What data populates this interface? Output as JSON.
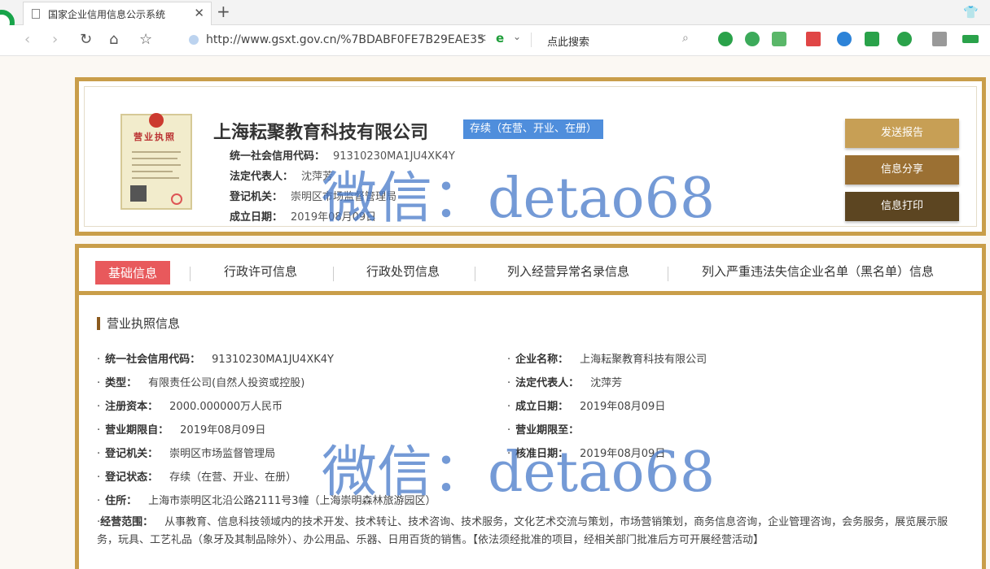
{
  "browser": {
    "tab_title": "国家企业信用信息公示系统",
    "tab_close": "✕",
    "new_tab": "+",
    "url": "http://www.gsxt.gov.cn/%7BDABF0FE7B29EAE35",
    "search_placeholder": "点此搜索"
  },
  "header": {
    "company_name": "上海耘聚教育科技有限公司",
    "status": "存续（在营、开业、在册）",
    "credit_code_label": "统一社会信用代码：",
    "credit_code": "91310230MA1JU4XK4Y",
    "legal_rep_label": "法定代表人：",
    "legal_rep": "沈萍芳",
    "authority_label": "登记机关：",
    "authority": "崇明区市场监督管理局",
    "founded_label": "成立日期：",
    "founded": "2019年08月09日",
    "license_title": "营业执照",
    "buttons": {
      "send_report": "发送报告",
      "share_info": "信息分享",
      "print_info": "信息打印"
    }
  },
  "tabs": [
    {
      "label": "基础信息",
      "active": true
    },
    {
      "label": "行政许可信息",
      "active": false
    },
    {
      "label": "行政处罚信息",
      "active": false
    },
    {
      "label": "列入经营异常名录信息",
      "active": false
    },
    {
      "label": "列入严重违法失信企业名单（黑名单）信息",
      "active": false
    }
  ],
  "details": {
    "section_title": "营业执照信息",
    "left": [
      {
        "k": "统一社会信用代码：",
        "v": "91310230MA1JU4XK4Y"
      },
      {
        "k": "类型：",
        "v": "有限责任公司(自然人投资或控股)"
      },
      {
        "k": "注册资本：",
        "v": "2000.000000万人民币"
      },
      {
        "k": "营业期限自：",
        "v": "2019年08月09日"
      },
      {
        "k": "登记机关：",
        "v": "崇明区市场监督管理局"
      },
      {
        "k": "登记状态：",
        "v": "存续（在营、开业、在册）"
      },
      {
        "k": "住所：",
        "v": "上海市崇明区北沿公路2111号3幢（上海崇明森林旅游园区）"
      }
    ],
    "right": [
      {
        "k": "企业名称：",
        "v": "上海耘聚教育科技有限公司"
      },
      {
        "k": "法定代表人：",
        "v": "沈萍芳"
      },
      {
        "k": "成立日期：",
        "v": "2019年08月09日"
      },
      {
        "k": "营业期限至：",
        "v": ""
      },
      {
        "k": "核准日期：",
        "v": "2019年08月09日"
      }
    ],
    "scope_label": "经营范围：",
    "scope_text": "从事教育、信息科技领域内的技术开发、技术转让、技术咨询、技术服务，文化艺术交流与策划，市场营销策划，商务信息咨询，企业管理咨询，会务服务，展览展示服务，玩具、工艺礼品（象牙及其制品除外）、办公用品、乐器、日用百货的销售。【依法须经批准的项目，经相关部门批准后方可开展经营活动】"
  },
  "watermark": "微信：detao68",
  "colors": {
    "frame_gold": "#c99e4a",
    "status_blue": "#4f8edc",
    "tab_active_red": "#e8595c",
    "btn_send": "#c79f55",
    "btn_share": "#9b7033",
    "btn_print": "#5c4521"
  }
}
